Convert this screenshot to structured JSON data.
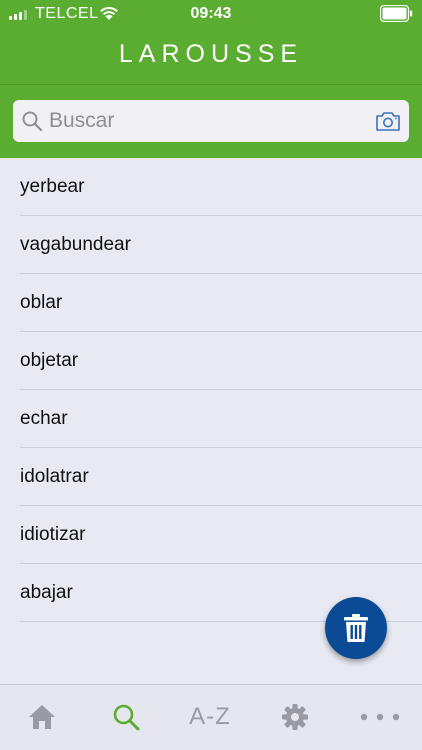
{
  "status_bar": {
    "carrier": "TELCEL",
    "time": "09:43"
  },
  "header": {
    "title": "LAROUSSE"
  },
  "search": {
    "placeholder": "Buscar",
    "value": ""
  },
  "history": [
    {
      "word": "yerbear"
    },
    {
      "word": "vagabundear"
    },
    {
      "word": "oblar"
    },
    {
      "word": "objetar"
    },
    {
      "word": "echar"
    },
    {
      "word": "idolatrar"
    },
    {
      "word": "idiotizar"
    },
    {
      "word": "abajar"
    }
  ],
  "tabs": [
    {
      "icon": "home-icon",
      "active": false
    },
    {
      "icon": "search-icon",
      "active": true
    },
    {
      "label": "A-Z",
      "active": false
    },
    {
      "icon": "gear-icon",
      "active": false
    },
    {
      "icon": "more-icon",
      "active": false
    }
  ],
  "colors": {
    "brand_green": "#5aad31",
    "fab_blue": "#0b4b96",
    "active_tab": "#5aad31",
    "inactive_tab": "#9a9aa3"
  }
}
